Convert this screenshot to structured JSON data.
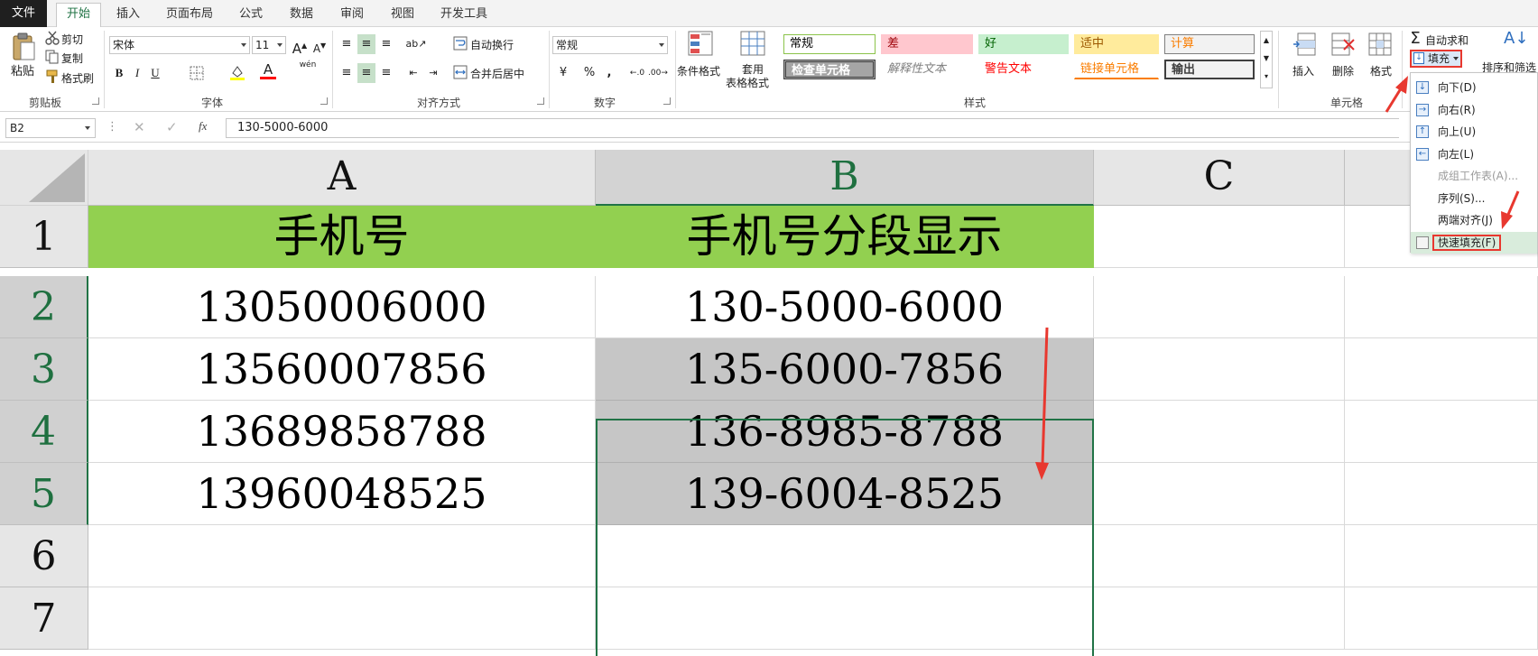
{
  "tabs": [
    "文件",
    "开始",
    "插入",
    "页面布局",
    "公式",
    "数据",
    "审阅",
    "视图",
    "开发工具"
  ],
  "clipboard": {
    "paste": "粘贴",
    "cut": "剪切",
    "copy": "复制",
    "format_painter": "格式刷",
    "label": "剪贴板"
  },
  "font": {
    "name": "宋体",
    "size": "11",
    "bold": "B",
    "italic": "I",
    "underline": "U",
    "label": "字体",
    "font_color": "#ff0000",
    "fill_color": "#ffff00",
    "phonetic": "wén"
  },
  "alignment": {
    "wrap": "自动换行",
    "merge": "合并后居中",
    "label": "对齐方式"
  },
  "number": {
    "format": "常规",
    "currency": "¥",
    "percent": "%",
    "comma": ",",
    "label": "数字"
  },
  "styles": {
    "conditional": "条件格式",
    "table_fmt_1": "套用",
    "table_fmt_2": "表格格式",
    "label": "样式",
    "cells": [
      {
        "text": "常规",
        "bg": "#ffffff",
        "color": "#000000",
        "border": "#8bc34a"
      },
      {
        "text": "差",
        "bg": "#ffc7ce",
        "color": "#9c0006",
        "border": "#ffc7ce"
      },
      {
        "text": "好",
        "bg": "#c6efce",
        "color": "#006100",
        "border": "#c6efce"
      },
      {
        "text": "适中",
        "bg": "#ffeb9c",
        "color": "#9c5700",
        "border": "#ffeb9c"
      },
      {
        "text": "计算",
        "bg": "#f2f2f2",
        "color": "#fa7d00",
        "border": "#7f7f7f"
      },
      {
        "text": "检查单元格",
        "bg": "#a5a5a5",
        "color": "#ffffff",
        "border": "#3f3f3f"
      },
      {
        "text": "解释性文本",
        "bg": "#ffffff",
        "color": "#7f7f7f",
        "border": "#ffffff"
      },
      {
        "text": "警告文本",
        "bg": "#ffffff",
        "color": "#ff0000",
        "border": "#ffffff"
      },
      {
        "text": "链接单元格",
        "bg": "#ffffff",
        "color": "#fa7d00",
        "border": "#ffffff"
      },
      {
        "text": "输出",
        "bg": "#f2f2f2",
        "color": "#3f3f3f",
        "border": "#3f3f3f"
      }
    ]
  },
  "cells_group": {
    "insert": "插入",
    "delete": "删除",
    "format": "格式",
    "label": "单元格"
  },
  "editing": {
    "autosum": "自动求和",
    "fill": "填充",
    "sort": "排序和筛选"
  },
  "fill_menu": [
    {
      "label": "向下(D)",
      "disabled": false,
      "highlight": false
    },
    {
      "label": "向右(R)",
      "disabled": false,
      "highlight": false
    },
    {
      "label": "向上(U)",
      "disabled": false,
      "highlight": false
    },
    {
      "label": "向左(L)",
      "disabled": false,
      "highlight": false
    },
    {
      "label": "成组工作表(A)...",
      "disabled": true,
      "highlight": false
    },
    {
      "label": "序列(S)...",
      "disabled": false,
      "highlight": false
    },
    {
      "label": "两端对齐(J)",
      "disabled": false,
      "highlight": false
    },
    {
      "label": "快速填充(F)",
      "disabled": false,
      "highlight": true
    }
  ],
  "formula_bar": {
    "name_box": "B2",
    "fx": "fx",
    "value": "130-5000-6000"
  },
  "columns": [
    "A",
    "B",
    "C"
  ],
  "rows": [
    "1",
    "2",
    "3",
    "4",
    "5",
    "6",
    "7"
  ],
  "sheet": {
    "header": [
      "手机号",
      "手机号分段显示"
    ],
    "data": [
      [
        "13050006000",
        "130-5000-6000"
      ],
      [
        "13560007856",
        "135-6000-7856"
      ],
      [
        "13689858788",
        "136-8985-8788"
      ],
      [
        "13960048525",
        "139-6004-8525"
      ]
    ]
  },
  "colors": {
    "accent": "#217346",
    "header_fill": "#92d050",
    "selection_fill": "#c6c6c6",
    "annotation": "#e8382f"
  }
}
